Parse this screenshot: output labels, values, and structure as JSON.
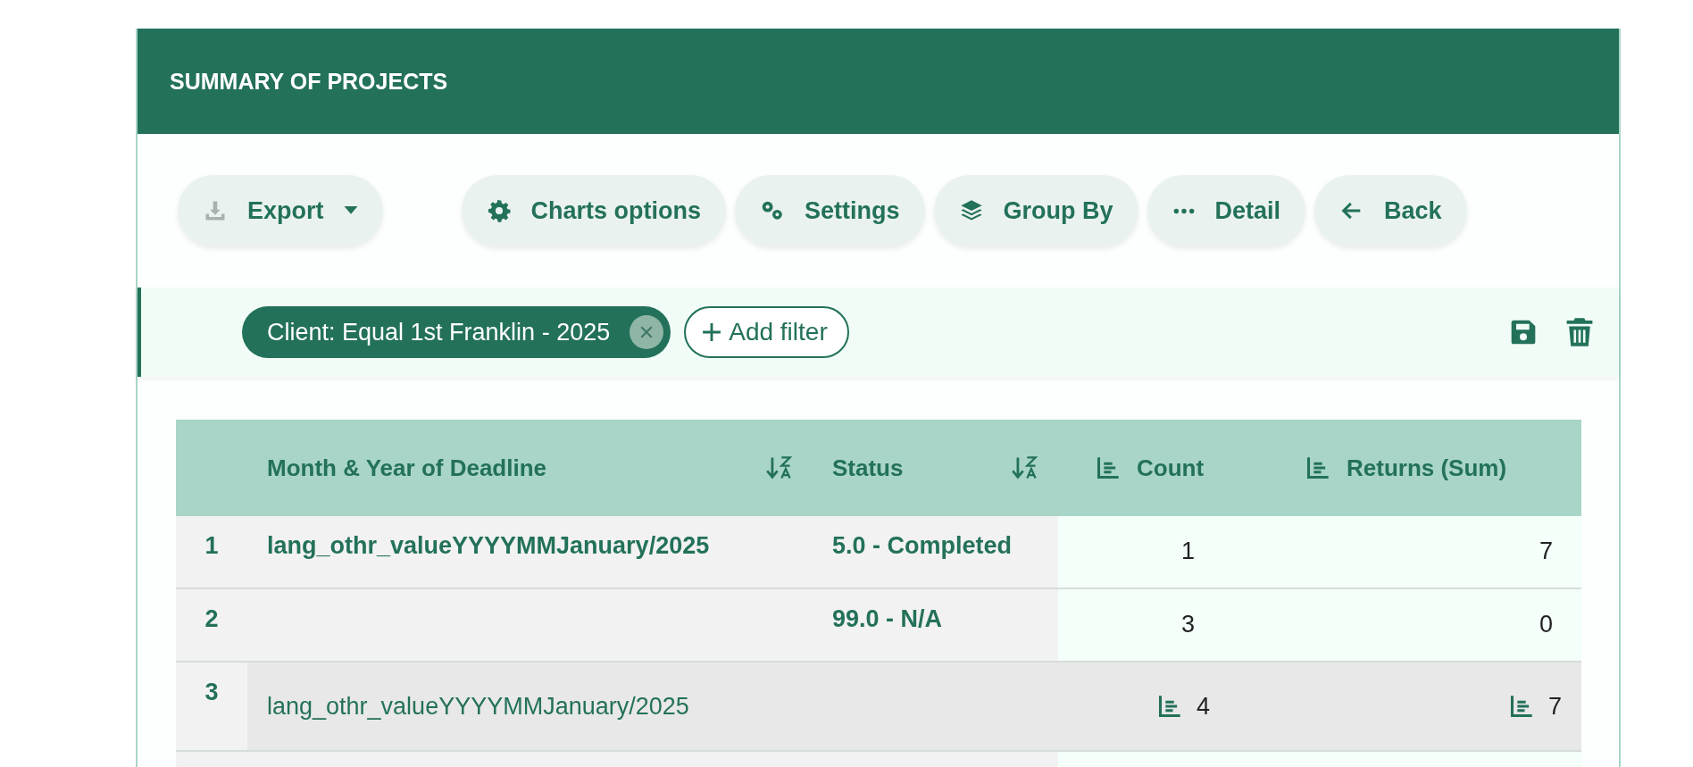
{
  "header": {
    "title": "SUMMARY OF PROJECTS"
  },
  "toolbar": [
    {
      "label": "Export",
      "kind": "export"
    },
    {
      "label": "Charts options",
      "kind": "charts"
    },
    {
      "label": "Settings",
      "kind": "settings"
    },
    {
      "label": "Group By",
      "kind": "group"
    },
    {
      "label": "Detail",
      "kind": "detail"
    },
    {
      "label": "Back",
      "kind": "back"
    }
  ],
  "filters": {
    "chips": [
      {
        "label": "Client: Equal 1st Franklin - 2025"
      }
    ],
    "add_label": "Add filter"
  },
  "table": {
    "columns": [
      {
        "label": "Month & Year of Deadline",
        "kind": "sortable"
      },
      {
        "label": "Status",
        "kind": "sortable"
      },
      {
        "label": "Count",
        "kind": "measure"
      },
      {
        "label": "Returns (Sum)",
        "kind": "measure"
      }
    ],
    "rows": [
      {
        "index": "1",
        "kind": "group",
        "cells": [
          "lang_othr_valueYYYYMMJanuary/2025",
          "5.0 - Completed",
          "1",
          "7"
        ]
      },
      {
        "index": "2",
        "kind": "group",
        "cells": [
          null,
          "99.0 - N/A",
          "3",
          "0"
        ]
      },
      {
        "index": "3",
        "kind": "subtotal",
        "cells": [
          "lang_othr_valueYYYYMMJanuary/2025",
          null,
          "4",
          "7"
        ]
      }
    ]
  }
}
